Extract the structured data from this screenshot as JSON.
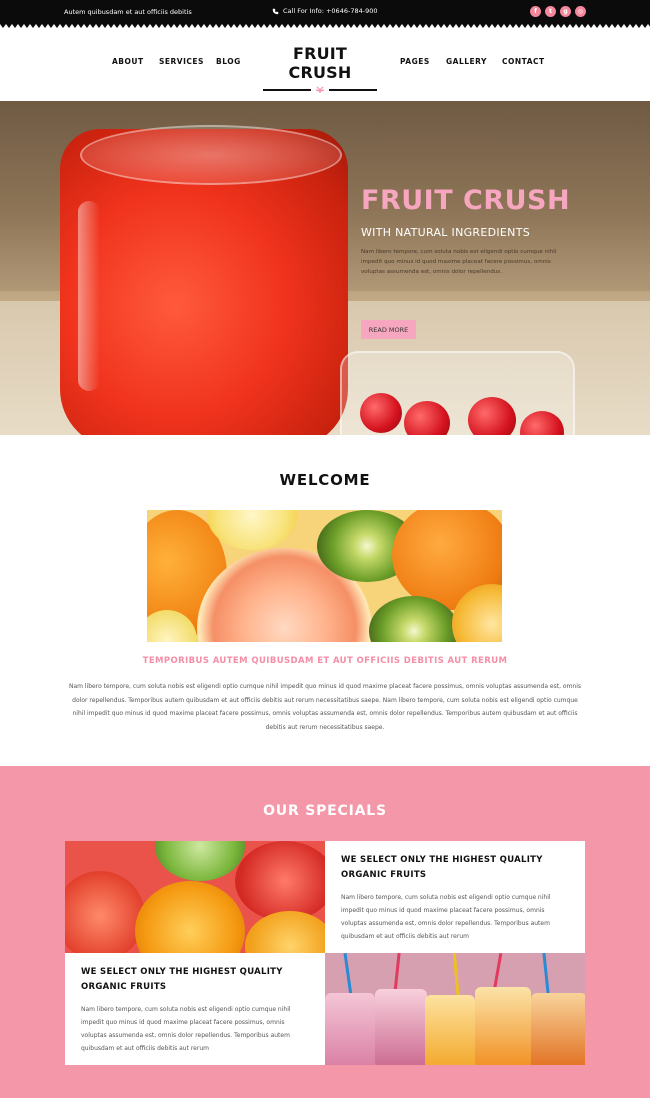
{
  "topbar": {
    "tagline": "Autem quibusdam et aut officiis debitis",
    "phone": "Call For Info: +0646-784-900",
    "social_icons": [
      "facebook-icon",
      "twitter-icon",
      "google-plus-icon",
      "instagram-icon"
    ]
  },
  "nav": {
    "left": [
      "ABOUT",
      "SERVICES",
      "BLOG"
    ],
    "right": [
      "PAGES",
      "GALLERY",
      "CONTACT"
    ]
  },
  "logo": {
    "title": "FRUIT CRUSH"
  },
  "hero": {
    "title": "FRUIT CRUSH",
    "subtitle": "WITH NATURAL INGREDIENTS",
    "description": "Nam libero tempore, cum soluta nobis est eligendi optio cumque nihil impedit quo minus id quod maxime placeat facere possimus, omnis voluptas assumenda est, omnis dolor repellendus.",
    "button": "READ MORE",
    "slides": 3,
    "active_slide": 2
  },
  "welcome": {
    "title": "WELCOME",
    "heading": "TEMPORIBUS AUTEM QUIBUSDAM ET AUT OFFICIIS DEBITIS AUT RERUM",
    "body": "Nam libero tempore, cum soluta nobis est eligendi optio cumque nihil impedit quo minus id quod maxime placeat facere possimus, omnis voluptas assumenda est, omnis dolor repellendus. Temporibus autem quibusdam et aut officiis debitis aut rerum necessitatibus saepe. Nam libero tempore, cum soluta nobis est eligendi optio cumque nihil impedit quo minus id quod maxime placeat facere possimus, omnis voluptas assumenda est, omnis dolor repellendus. Temporibus autem quibusdam et aut officiis debitis aut rerum necessitatibus saepe."
  },
  "specials": {
    "title": "OUR SPECIALS",
    "cards": [
      {
        "heading": "WE SELECT ONLY THE HIGHEST QUALITY ORGANIC FRUITS",
        "body": "Nam libero tempore, cum soluta nobis est eligendi optio cumque nihil impedit quo minus id quod maxime placeat facere possimus, omnis voluptas assumenda est, omnis dolor repellendus. Temporibus autem quibusdam et aut officiis debitis aut rerum"
      },
      {
        "heading": "WE SELECT ONLY THE HIGHEST QUALITY ORGANIC FRUITS",
        "body": "Nam libero tempore, cum soluta nobis est eligendi optio cumque nihil impedit quo minus id quod maxime placeat facere possimus, omnis voluptas assumenda est, omnis dolor repellendus. Temporibus autem quibusdam et aut officiis debitis aut rerum"
      }
    ]
  },
  "colors": {
    "accent_pink": "#f6a7bf",
    "specials_bg": "#f497a8",
    "topbar_bg": "#0b0b0b"
  }
}
